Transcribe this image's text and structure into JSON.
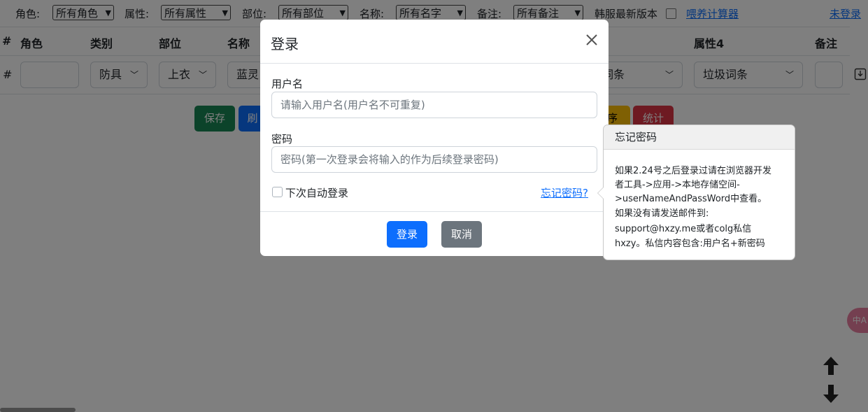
{
  "filters": [
    {
      "label": "角色:",
      "value": "所有角色"
    },
    {
      "label": "属性:",
      "value": "所有属性"
    },
    {
      "label": "部位:",
      "value": "所有部位"
    },
    {
      "label": "名称:",
      "value": "所有名字"
    },
    {
      "label": "备注:",
      "value": "所有备注"
    }
  ],
  "korean_version_label": "韩服最新版本",
  "calculator_link": "喂养计算器",
  "login_status_link": "未登录",
  "table": {
    "headers": [
      "#",
      "角色",
      "类别",
      "部位",
      "名称",
      "属性4",
      "备注"
    ],
    "row": {
      "index": "#",
      "category": "防具",
      "slot": "上衣",
      "name_partial": "蓝灵",
      "attr3_partial": "词条",
      "attr4": "垃圾词条"
    }
  },
  "buttons": {
    "save": "保存",
    "refresh_partial": "刷",
    "sort_partial": "序",
    "stats": "统计"
  },
  "modal": {
    "title": "登录",
    "username_label": "用户名",
    "username_placeholder": "请输入用户名(用户名不可重复)",
    "password_label": "密码",
    "password_placeholder": "密码(第一次登录会将输入的作为后续登录密码)",
    "auto_login_label": "下次自动登录",
    "forgot_link": "忘记密码?",
    "login_button": "登录",
    "cancel_button": "取消"
  },
  "popover": {
    "title": "忘记密码",
    "lines": [
      "如果2.24号之后登录过请在浏览器开发",
      "者工具->应用->本地存储空间-",
      ">userNameAndPassWord中查看。",
      "如果没有请发送邮件到:",
      "support@hxzy.me或者colg私信",
      "hxzy。私信内容包含:用户名+新密码"
    ]
  },
  "colors": {
    "save": "#198754",
    "refresh": "#0d6efd",
    "sort": "#ffc107",
    "stats": "#dc3545",
    "login": "#0d6efd",
    "cancel": "#6c757d"
  }
}
